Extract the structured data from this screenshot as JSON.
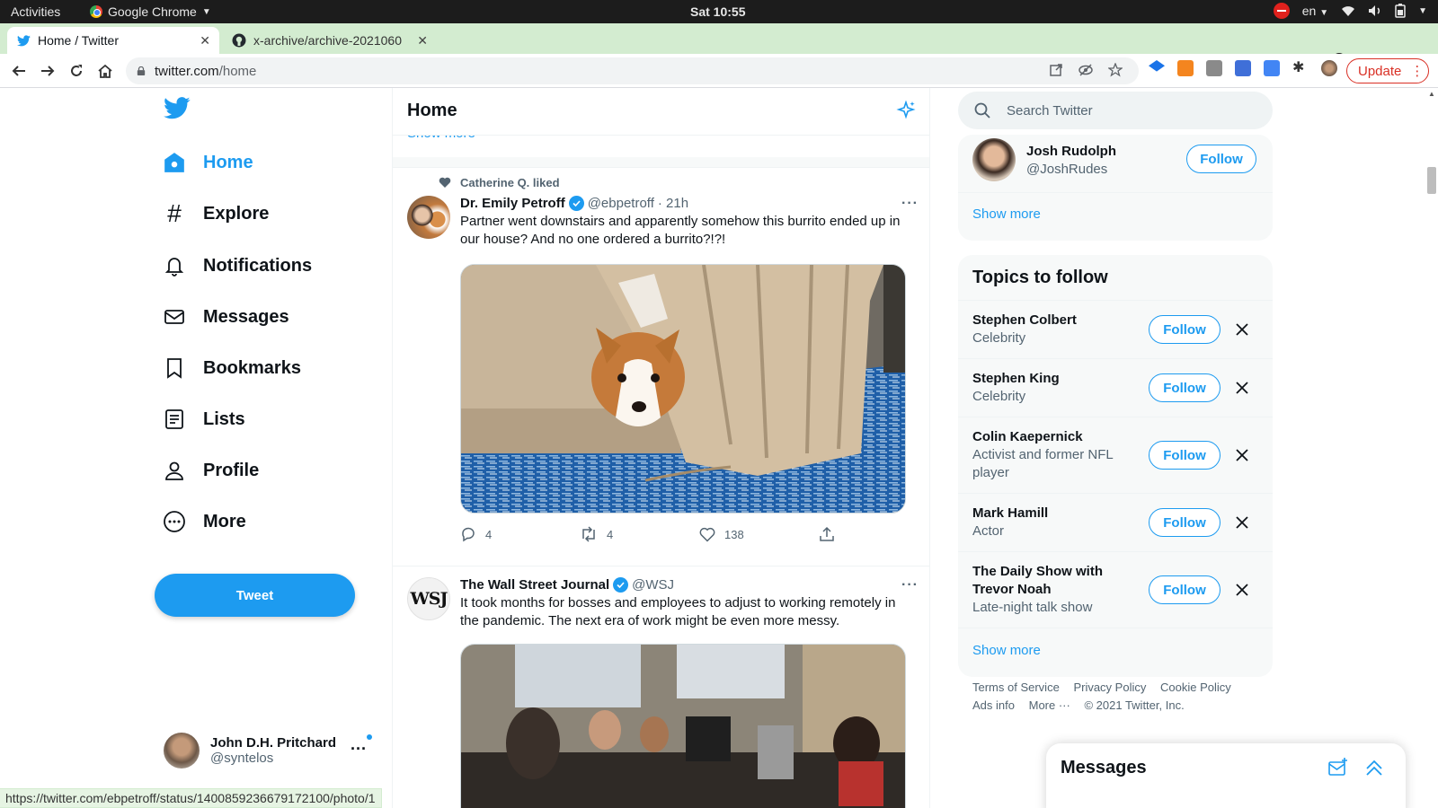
{
  "os": {
    "activities": "Activities",
    "app_name": "Google Chrome",
    "clock": "Sat 10:55",
    "lang": "en"
  },
  "tabs": [
    {
      "title": "Home / Twitter"
    },
    {
      "title": "x-archive/archive-2021060"
    }
  ],
  "toolbar": {
    "url_host": "twitter.com",
    "url_path": "/home",
    "update_label": "Update"
  },
  "nav": {
    "items": [
      {
        "label": "Home"
      },
      {
        "label": "Explore"
      },
      {
        "label": "Notifications"
      },
      {
        "label": "Messages"
      },
      {
        "label": "Bookmarks"
      },
      {
        "label": "Lists"
      },
      {
        "label": "Profile"
      },
      {
        "label": "More"
      }
    ],
    "tweet_button": "Tweet",
    "account": {
      "name": "John D.H. Pritchard",
      "handle": "@syntelos"
    }
  },
  "timeline": {
    "title": "Home",
    "show_more_cut": "Show more",
    "tweets": [
      {
        "social_context": "Catherine Q. liked",
        "name": "Dr. Emily Petroff",
        "handle": "@ebpetroff",
        "time": "· 21h",
        "text": "Partner went downstairs and apparently somehow this burrito ended up in our house? And no one ordered a burrito?!?!",
        "replies": "4",
        "retweets": "4",
        "likes": "138"
      },
      {
        "name": "The Wall Street Journal",
        "handle": "@WSJ",
        "avatar_text": "WSJ",
        "text": "It took months for bosses and employees to adjust to working remotely in the pandemic. The next era of work might be even more messy."
      }
    ]
  },
  "sidebar": {
    "search_placeholder": "Search Twitter",
    "who_to_follow": {
      "name": "Josh Rudolph",
      "handle": "@JoshRudes",
      "follow": "Follow",
      "show_more": "Show more"
    },
    "topics": {
      "title": "Topics to follow",
      "items": [
        {
          "name": "Stephen Colbert",
          "category": "Celebrity",
          "follow": "Follow"
        },
        {
          "name": "Stephen King",
          "category": "Celebrity",
          "follow": "Follow"
        },
        {
          "name": "Colin Kaepernick",
          "category": "Activist and former NFL player",
          "follow": "Follow"
        },
        {
          "name": "Mark Hamill",
          "category": "Actor",
          "follow": "Follow"
        },
        {
          "name": "The Daily Show with Trevor Noah",
          "category": "Late-night talk show",
          "follow": "Follow"
        }
      ],
      "show_more": "Show more"
    },
    "footer": {
      "terms": "Terms of Service",
      "privacy": "Privacy Policy",
      "cookie": "Cookie Policy",
      "ads": "Ads info",
      "more": "More ···",
      "copyright": "© 2021 Twitter, Inc."
    },
    "messages_title": "Messages"
  },
  "status_url": "https://twitter.com/ebpetroff/status/1400859236679172100/photo/1",
  "colors": {
    "twitter_blue": "#1d9bf0",
    "tab_strip": "#d3ecd0",
    "update_red": "#d93025"
  }
}
